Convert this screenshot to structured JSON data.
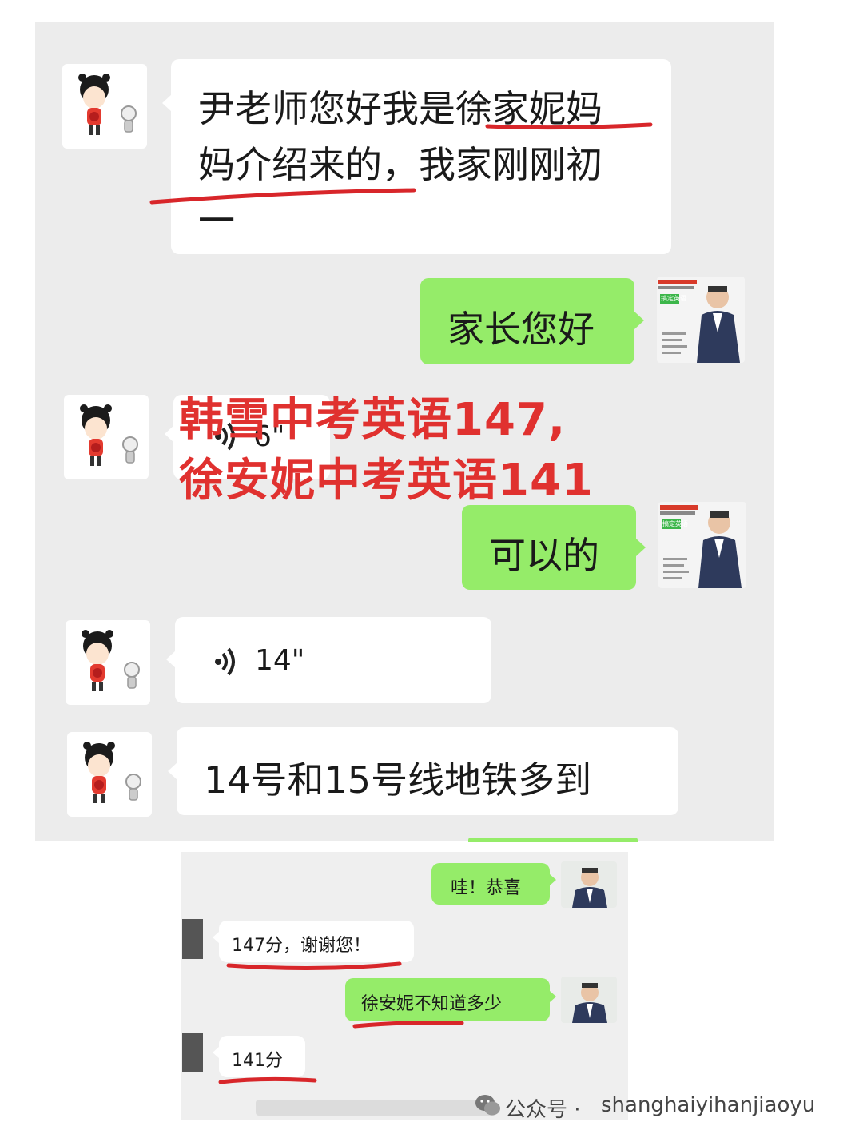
{
  "messages": {
    "m1": "尹老师您好我是徐家妮妈",
    "m1b": "妈介绍来的，我家刚刚初",
    "m1c": "一",
    "m2": "家长您好",
    "voice1": "6\"",
    "m3": "可以的",
    "voice2": "14\"",
    "m4": "14号和15号线地铁多到"
  },
  "sticker": {
    "line1": "韩雪中考英语147,",
    "line2": "徐安妮中考英语141"
  },
  "teacher_card": {
    "badge": "搞定英语"
  },
  "chat2": {
    "m1": "哇！恭喜",
    "m2": "147分，谢谢您！",
    "m3": "徐安妮不知道多少",
    "m4": "141分"
  },
  "footer": {
    "prefix": "公众号 · ",
    "account": "shanghaiyihanjiaoyu"
  },
  "colors": {
    "green_bubble": "#95ec69",
    "white_bubble": "#ffffff",
    "chat_bg": "#ececec",
    "sticker_red": "#e0312f",
    "underline_red": "#d8262a"
  },
  "icons": [
    "cartoon-girl-avatar",
    "teacher-avatar",
    "voice-wave-icon",
    "wechat-logo-icon"
  ]
}
